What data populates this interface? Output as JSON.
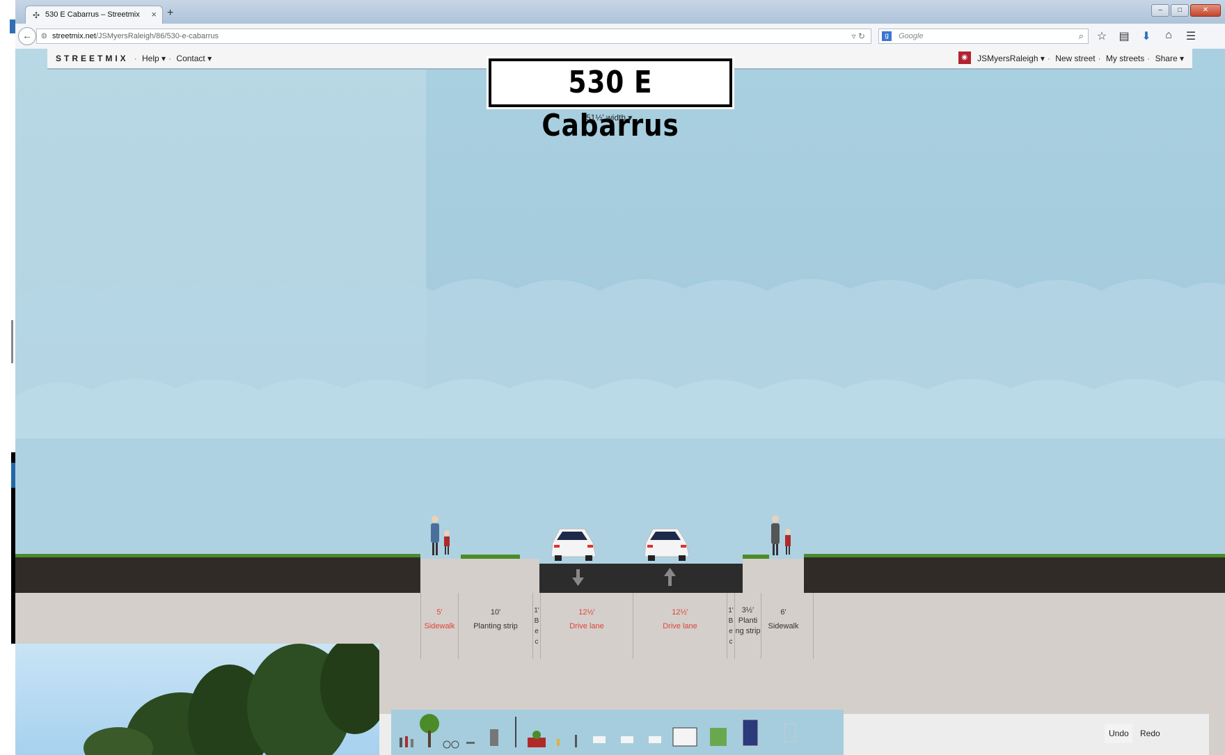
{
  "browser": {
    "tab_title": "530 E Cabarrus – Streetmix",
    "tab_close": "×",
    "new_tab": "+",
    "url_domain": "streetmix.net",
    "url_path": "/JSMyersRaleigh/86/530-e-cabarrus",
    "search_placeholder": "Google",
    "window_controls": [
      "–",
      "□",
      "✕"
    ]
  },
  "app": {
    "logo": "STREETMIX",
    "menu_left": [
      "Help ▾",
      "Contact ▾"
    ],
    "user": "JSMyersRaleigh ▾",
    "menu_right": [
      "New street",
      "My streets",
      "Share ▾"
    ]
  },
  "street": {
    "name": "530 E Cabarrus",
    "width_label": "51½' width  ▾"
  },
  "segments": [
    {
      "width": "5'",
      "name": "Sidewalk",
      "warning": true
    },
    {
      "width": "10'",
      "name": "Planting strip",
      "warning": false
    },
    {
      "width": "1'",
      "name": "B e c",
      "warning": false
    },
    {
      "width": "12½'",
      "name": "Drive lane",
      "warning": true,
      "direction": "inbound"
    },
    {
      "width": "12½'",
      "name": "Drive lane",
      "warning": true,
      "direction": "outbound"
    },
    {
      "width": "1'",
      "name": "B e c",
      "warning": false
    },
    {
      "width": "3½'",
      "name": "Planti ng strip",
      "warning": false
    },
    {
      "width": "6'",
      "name": "Sidewalk",
      "warning": false
    }
  ],
  "toolbar": {
    "undo": "Undo",
    "redo": "Redo"
  },
  "colors": {
    "sky": "#a4cbdc",
    "dirt": "#312b27",
    "asphalt": "#2c2c2c",
    "warning": "#e0433b",
    "grass": "#4b8b2a"
  }
}
